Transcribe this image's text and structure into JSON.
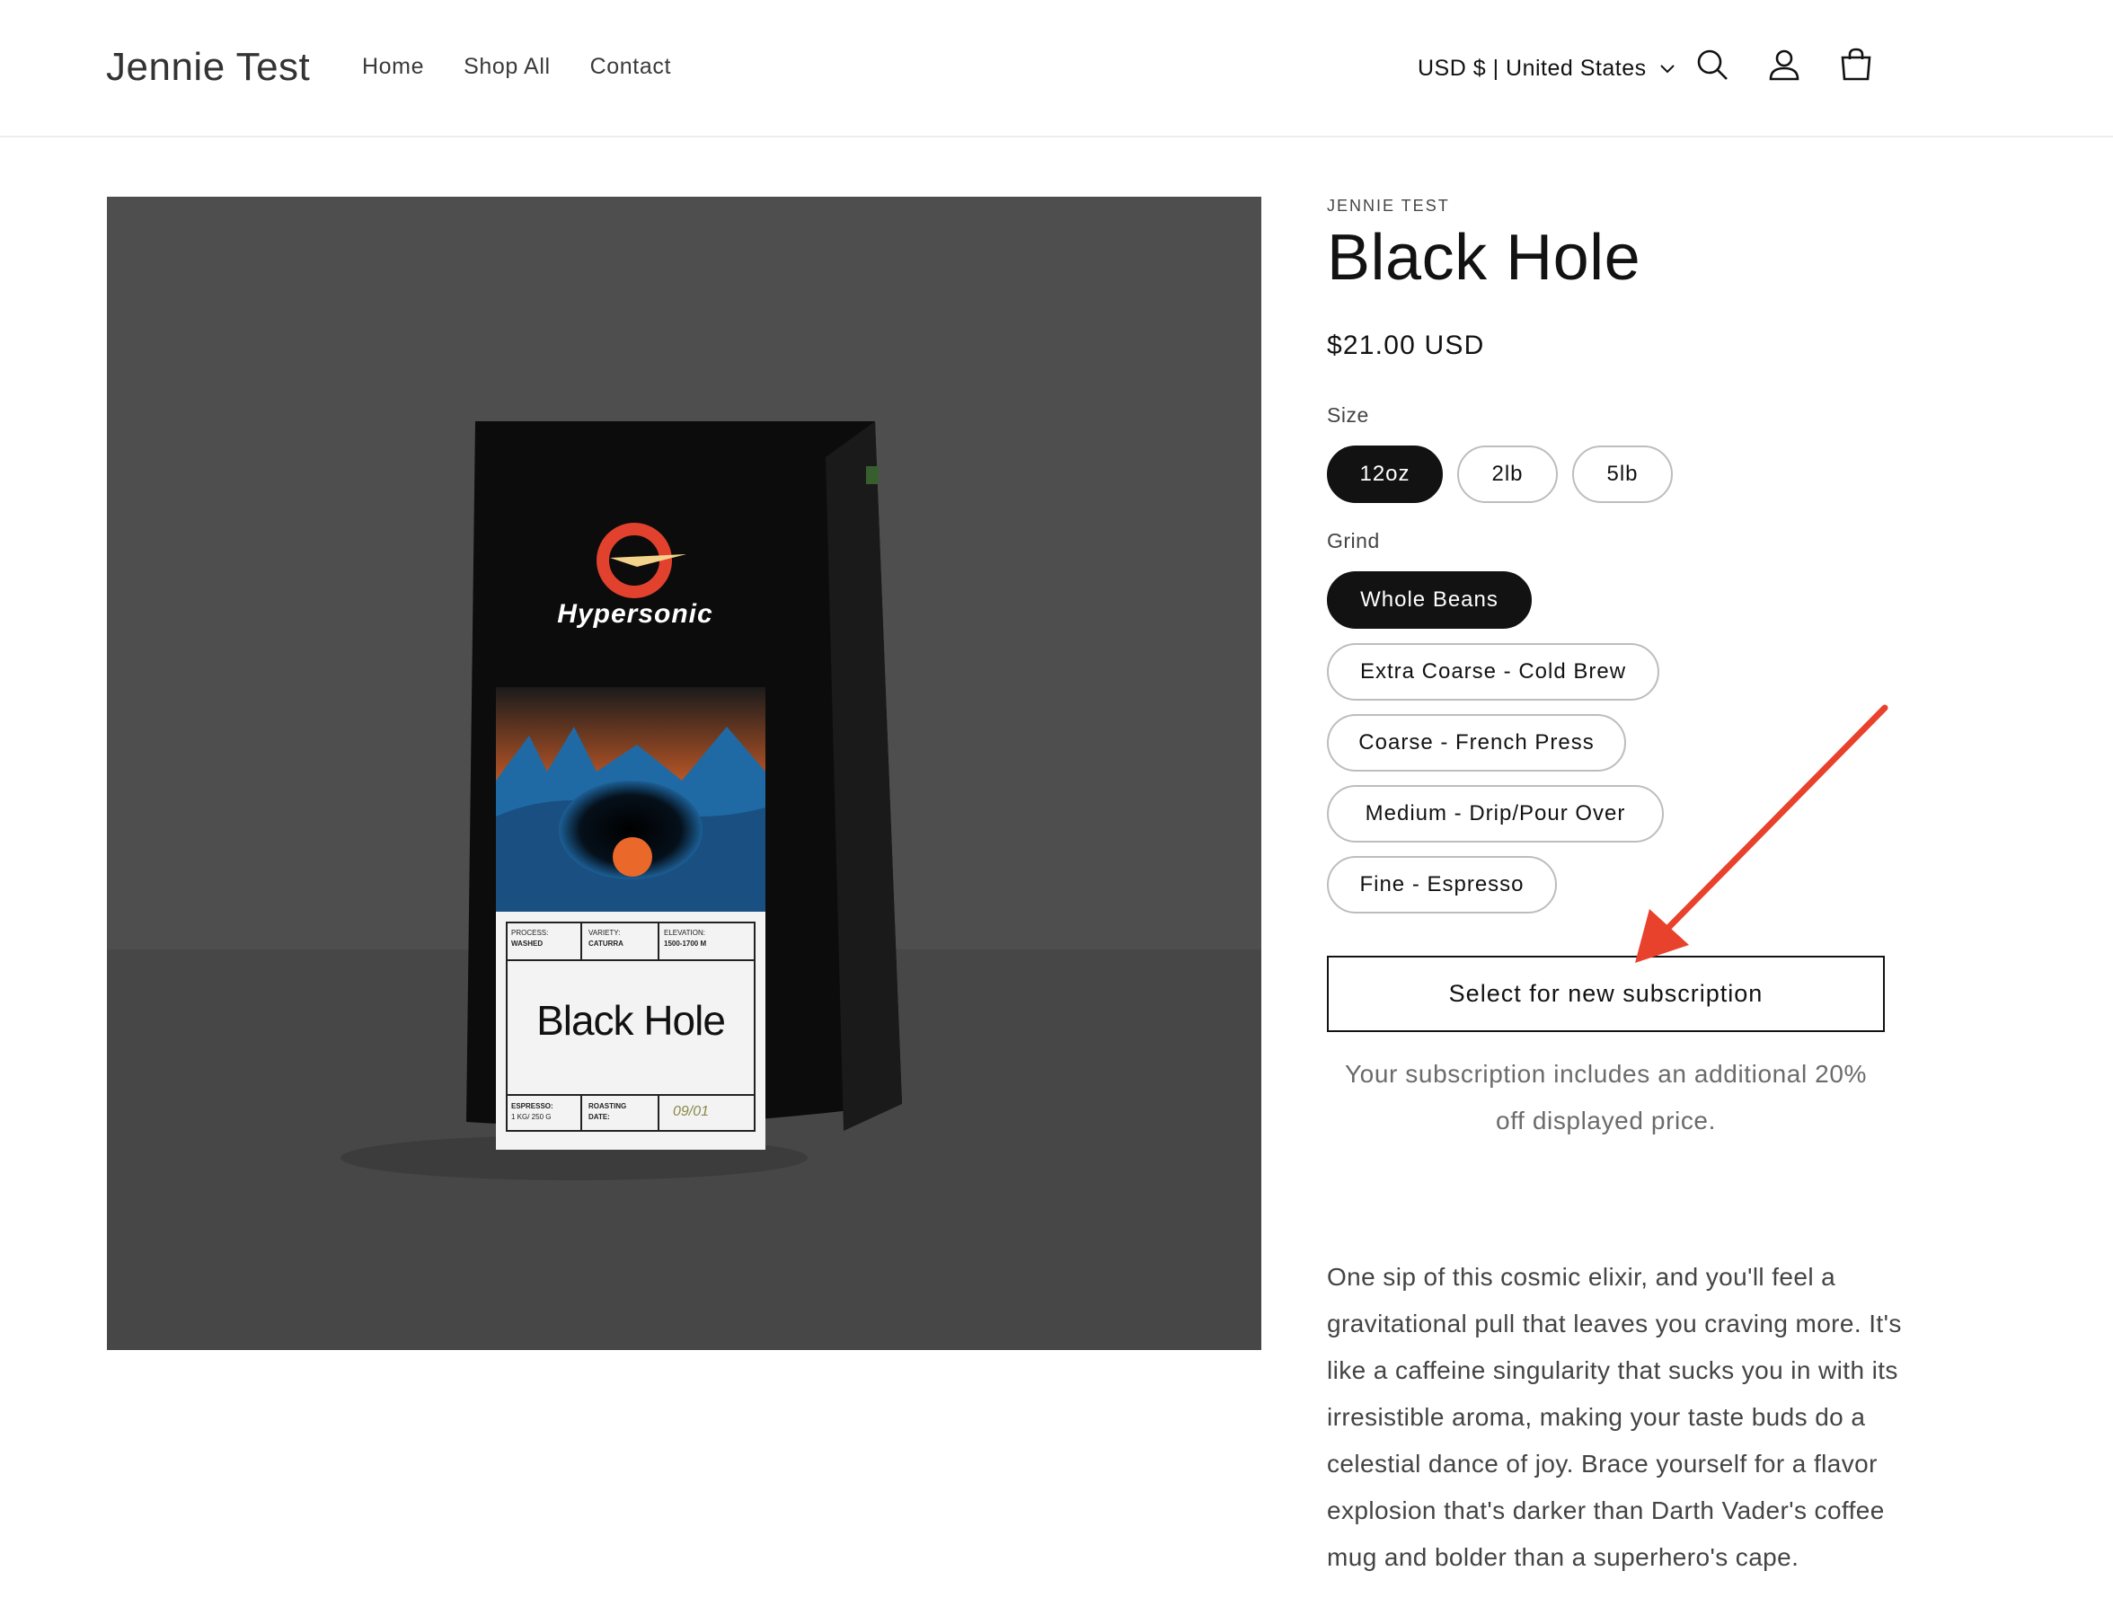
{
  "header": {
    "brand": "Jennie Test",
    "nav": [
      "Home",
      "Shop All",
      "Contact"
    ],
    "locale": "USD $ | United States",
    "icons": [
      "search-icon",
      "account-icon",
      "cart-icon"
    ]
  },
  "product": {
    "vendor": "JENNIE TEST",
    "title": "Black Hole",
    "price": "$21.00 USD",
    "size_label": "Size",
    "sizes": [
      "12oz",
      "2lb",
      "5lb"
    ],
    "selected_size": "12oz",
    "grind_label": "Grind",
    "grinds": [
      "Whole Beans",
      "Extra Coarse - Cold Brew",
      "Coarse - French Press",
      "Medium - Drip/Pour Over",
      "Fine - Espresso"
    ],
    "selected_grind": "Whole Beans",
    "subscription_button": "Select for new subscription",
    "subscription_note": "Your subscription includes an additional 20% off displayed price.",
    "description": "One sip of this cosmic elixir, and you'll feel a gravitational pull that leaves you craving more. It's like a caffeine singularity that sucks you in with its irresistible aroma, making your taste buds do a celestial dance of joy. Brace yourself for a flavor explosion that's darker than Darth Vader's coffee mug and bolder than a superhero's cape."
  },
  "bag": {
    "brand": "Hypersonic",
    "name": "Black Hole",
    "process_label": "PROCESS:",
    "process": "WASHED",
    "variety_label": "VARIETY:",
    "variety": "CATURRA",
    "elevation_label": "ELEVATION:",
    "elevation": "1500-1700 M",
    "espresso_label": "ESPRESSO:",
    "espresso": "1 KG/ 250 G",
    "roasting_label": "ROASTING",
    "roasting_date_label": "DATE:",
    "roasting_date": "09/01"
  },
  "colors": {
    "accent": "#121212",
    "arrow": "#e8412c",
    "image_bg": "#4e4e4e"
  }
}
